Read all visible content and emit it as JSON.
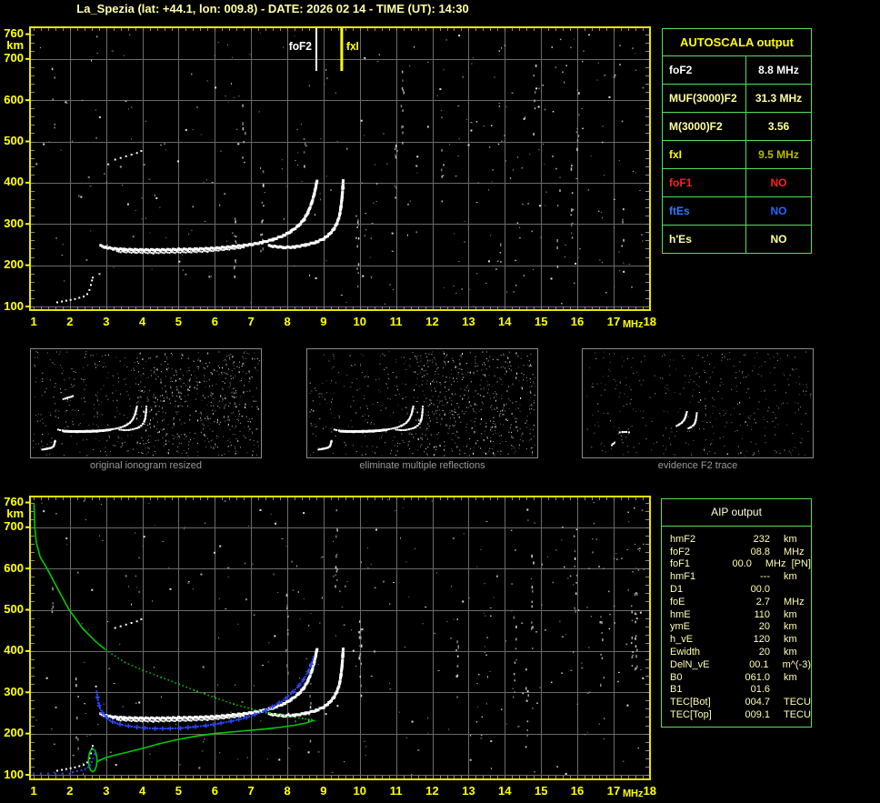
{
  "title": "La_Spezia (lat: +44.1, lon: 009.8) - DATE: 2026 02 14 - TIME (UT): 14:30",
  "colors": {
    "axis_yellow": "#ffff00",
    "plot_border": "#e8e800",
    "grid_gray": "#6a6a6a",
    "tick_gray": "#8a8a8a",
    "table_green": "#55e055",
    "trace_white": "#ffffff",
    "trace_blue": "#2a46ff",
    "profile_green": "#00cc00",
    "caption_gray": "#9a9a9a",
    "title_yellow": "#ffffa6"
  },
  "autoscala_table": {
    "title": "AUTOSCALA output",
    "rows": [
      {
        "label": "foF2",
        "value": "8.8 MHz",
        "label_color": "#ffffff",
        "value_color": "#ffffff"
      },
      {
        "label": "MUF(3000)F2",
        "value": "31.3 MHz",
        "label_color": "#ffff9c",
        "value_color": "#ffff9c"
      },
      {
        "label": "M(3000)F2",
        "value": "3.56",
        "label_color": "#ffff9c",
        "value_color": "#ffff9c"
      },
      {
        "label": "fxI",
        "value": "9.5 MHz",
        "label_color": "#ffff00",
        "value_color": "#b9b900"
      },
      {
        "label": "foF1",
        "value": "NO",
        "label_color": "#ff2020",
        "value_color": "#ff2020"
      },
      {
        "label": "ftEs",
        "value": "NO",
        "label_color": "#3377ff",
        "value_color": "#2266ff"
      },
      {
        "label": "h'Es",
        "value": "NO",
        "label_color": "#ffff9c",
        "value_color": "#ffff9c"
      }
    ]
  },
  "aip_table": {
    "title": "AIP output",
    "rows": [
      {
        "name": "hmF2",
        "value": "232",
        "unit": "km",
        "note": ""
      },
      {
        "name": "foF2",
        "value": "08.8",
        "unit": "MHz",
        "note": ""
      },
      {
        "name": "foF1",
        "value": "00.0",
        "unit": "MHz",
        "note": "  [PN]"
      },
      {
        "name": "hmF1",
        "value": "---",
        "unit": "km",
        "note": ""
      },
      {
        "name": "D1",
        "value": "00.0",
        "unit": "",
        "note": ""
      },
      {
        "name": "foE",
        "value": "2.7",
        "unit": "MHz",
        "note": ""
      },
      {
        "name": "hmE",
        "value": "110",
        "unit": "km",
        "note": ""
      },
      {
        "name": "ymE",
        "value": "20",
        "unit": "km",
        "note": ""
      },
      {
        "name": "h_vE",
        "value": "120",
        "unit": "km",
        "note": ""
      },
      {
        "name": "Ewidth",
        "value": "20",
        "unit": "km",
        "note": ""
      },
      {
        "name": "DelN_vE",
        "value": "00.1",
        "unit": "m^(-3)",
        "note": ""
      },
      {
        "name": "B0",
        "value": "061.0",
        "unit": "km",
        "note": ""
      },
      {
        "name": "B1",
        "value": "01.6",
        "unit": "",
        "note": ""
      },
      {
        "name": "TEC[Bot]",
        "value": "004.7",
        "unit": "TECU",
        "note": ""
      },
      {
        "name": "TEC[Top]",
        "value": "009.1",
        "unit": "TECU",
        "note": ""
      }
    ]
  },
  "thumbnails": [
    {
      "caption": "original ionogram resized",
      "seed": 41,
      "noise": 520,
      "extra_right": 300,
      "dim": false,
      "series": [
        "E_trace",
        "F2_O",
        "F2_upper",
        "F2_X",
        "arc460"
      ]
    },
    {
      "caption": "eliminate multiple reflections",
      "seed": 87,
      "noise": 500,
      "extra_right": 300,
      "dim": false,
      "series": [
        "E_trace",
        "F2_O",
        "F2_upper",
        "F2_X"
      ]
    },
    {
      "caption": "evidence F2 trace",
      "seed": 55,
      "noise": 330,
      "extra_right": 60,
      "dim": true,
      "series": [
        "frag_hook",
        "frag_mid",
        "frag_O_rise",
        "frag_X_rise"
      ]
    }
  ],
  "chart_data": [
    {
      "id": "top_ionogram",
      "type": "scatter",
      "xlabel": "MHz",
      "ylabel": "km",
      "xlim": [
        1,
        18
      ],
      "ylim": [
        100,
        760
      ],
      "grid": true,
      "x_ticks": [
        1,
        2,
        3,
        4,
        5,
        6,
        7,
        8,
        9,
        10,
        11,
        12,
        13,
        14,
        15,
        16,
        17,
        18
      ],
      "y_ticks": [
        760,
        700,
        600,
        500,
        400,
        300,
        200,
        100
      ],
      "markers": [
        {
          "label": "foF2",
          "f": 8.8,
          "color": "#ffffff"
        },
        {
          "label": "fxI",
          "f": 9.5,
          "color": "#ffff00"
        }
      ],
      "noise_seed": 7,
      "series": [
        "E_trace",
        "F2_O",
        "F2_upper",
        "F2_X",
        "arc460"
      ]
    },
    {
      "id": "bottom_ionogram",
      "type": "scatter",
      "xlabel": "MHz",
      "ylabel": "km",
      "xlim": [
        1,
        18
      ],
      "ylim": [
        100,
        760
      ],
      "grid": true,
      "x_ticks": [
        1,
        2,
        3,
        4,
        5,
        6,
        7,
        8,
        9,
        10,
        11,
        12,
        13,
        14,
        15,
        16,
        17,
        18
      ],
      "y_ticks": [
        760,
        700,
        600,
        500,
        400,
        300,
        200,
        100
      ],
      "markers": [],
      "noise_seed": 29,
      "series": [
        "E_trace",
        "F2_O",
        "F2_upper",
        "F2_X",
        "arc460",
        "profile_topside_solid",
        "profile_topside_dotted",
        "profile_bottomside",
        "profile_valley_loop",
        "blue_bottom",
        "blue_hook",
        "blue_main"
      ]
    }
  ],
  "series_defs": {
    "E_trace": {
      "color": "#ffffff",
      "mode": "points",
      "size": 2,
      "points": [
        [
          1.65,
          110
        ],
        [
          1.78,
          112
        ],
        [
          1.9,
          114
        ],
        [
          2.02,
          116
        ],
        [
          2.14,
          118
        ],
        [
          2.26,
          121
        ],
        [
          2.38,
          124
        ],
        [
          2.48,
          130
        ],
        [
          2.54,
          140
        ],
        [
          2.58,
          152
        ],
        [
          2.61,
          163
        ],
        [
          2.63,
          170
        ]
      ]
    },
    "F2_O": {
      "color": "#ffffff",
      "mode": "pixels",
      "size": 3,
      "points": [
        [
          2.85,
          247
        ],
        [
          3.0,
          243
        ],
        [
          3.2,
          240
        ],
        [
          3.5,
          238
        ],
        [
          4.0,
          237
        ],
        [
          4.5,
          237
        ],
        [
          5.0,
          238
        ],
        [
          5.5,
          239
        ],
        [
          6.0,
          241
        ],
        [
          6.5,
          245
        ],
        [
          7.0,
          250
        ],
        [
          7.3,
          255
        ],
        [
          7.6,
          262
        ],
        [
          7.9,
          272
        ],
        [
          8.1,
          282
        ],
        [
          8.3,
          295
        ],
        [
          8.45,
          310
        ],
        [
          8.57,
          328
        ],
        [
          8.67,
          350
        ],
        [
          8.74,
          372
        ],
        [
          8.79,
          392
        ],
        [
          8.82,
          405
        ]
      ]
    },
    "F2_upper": {
      "color": "#ffffff",
      "mode": "pixels",
      "size": 2,
      "points": [
        [
          3.3,
          233
        ],
        [
          3.8,
          231
        ],
        [
          4.3,
          230
        ],
        [
          4.8,
          231
        ],
        [
          5.3,
          232
        ],
        [
          5.8,
          234
        ],
        [
          6.3,
          238
        ],
        [
          6.8,
          243
        ]
      ]
    },
    "F2_X": {
      "color": "#ffffff",
      "mode": "pixels",
      "size": 3,
      "points": [
        [
          7.5,
          247
        ],
        [
          7.9,
          243
        ],
        [
          8.2,
          244
        ],
        [
          8.5,
          249
        ],
        [
          8.8,
          256
        ],
        [
          9.0,
          264
        ],
        [
          9.15,
          274
        ],
        [
          9.28,
          287
        ],
        [
          9.37,
          302
        ],
        [
          9.44,
          320
        ],
        [
          9.48,
          342
        ],
        [
          9.51,
          365
        ],
        [
          9.53,
          388
        ],
        [
          9.54,
          405
        ]
      ]
    },
    "arc460": {
      "color": "#ffffff",
      "mode": "points",
      "size": 2,
      "points": [
        [
          3.25,
          456
        ],
        [
          3.4,
          460
        ],
        [
          3.55,
          464
        ],
        [
          3.7,
          468
        ],
        [
          3.85,
          472
        ],
        [
          3.97,
          477
        ]
      ]
    },
    "profile_topside_solid": {
      "color": "#00cc00",
      "mode": "line",
      "size": 1.6,
      "points": [
        [
          1.01,
          757
        ],
        [
          1.03,
          700
        ],
        [
          1.08,
          660
        ],
        [
          1.18,
          628
        ],
        [
          1.37,
          600
        ],
        [
          1.62,
          558
        ],
        [
          1.98,
          500
        ],
        [
          2.35,
          455
        ],
        [
          2.7,
          424
        ],
        [
          2.96,
          405
        ]
      ]
    },
    "profile_topside_dotted": {
      "color": "#00cc00",
      "mode": "dotline",
      "size": 1.4,
      "points": [
        [
          2.96,
          405
        ],
        [
          3.5,
          374
        ],
        [
          4.0,
          355
        ],
        [
          4.5,
          338
        ],
        [
          5.0,
          321
        ],
        [
          5.5,
          304
        ],
        [
          6.0,
          288
        ],
        [
          6.5,
          273
        ],
        [
          7.0,
          261
        ],
        [
          7.5,
          251
        ],
        [
          8.0,
          243
        ],
        [
          8.4,
          238
        ],
        [
          8.65,
          235
        ],
        [
          8.73,
          232
        ]
      ]
    },
    "profile_bottomside": {
      "color": "#00cc00",
      "mode": "line",
      "size": 1.6,
      "points": [
        [
          8.73,
          232
        ],
        [
          8.55,
          226
        ],
        [
          8.2,
          220
        ],
        [
          7.8,
          215
        ],
        [
          7.4,
          211
        ],
        [
          7.0,
          208
        ],
        [
          6.5,
          204
        ],
        [
          6.0,
          200
        ],
        [
          5.5,
          194
        ],
        [
          5.0,
          186
        ],
        [
          4.5,
          176
        ],
        [
          4.0,
          164
        ],
        [
          3.6,
          155
        ],
        [
          3.2,
          147
        ],
        [
          2.95,
          140
        ],
        [
          2.8,
          134
        ],
        [
          2.75,
          131
        ]
      ]
    },
    "profile_valley_loop": {
      "color": "#00cc00",
      "mode": "line",
      "size": 1.6,
      "points": [
        [
          2.75,
          135
        ],
        [
          2.73,
          149
        ],
        [
          2.69,
          159
        ],
        [
          2.63,
          163
        ],
        [
          2.57,
          159
        ],
        [
          2.53,
          149
        ],
        [
          2.51,
          135
        ],
        [
          2.53,
          121
        ],
        [
          2.57,
          111
        ],
        [
          2.63,
          107
        ],
        [
          2.69,
          111
        ],
        [
          2.73,
          121
        ],
        [
          2.75,
          135
        ]
      ]
    },
    "blue_bottom": {
      "color": "#2a46ff",
      "mode": "points",
      "size": 2,
      "points": [
        [
          1.0,
          103
        ],
        [
          1.2,
          103
        ],
        [
          1.4,
          103
        ],
        [
          1.6,
          103
        ],
        [
          1.8,
          103
        ],
        [
          2.0,
          103
        ]
      ]
    },
    "blue_hook": {
      "color": "#2a46ff",
      "mode": "points",
      "size": 2,
      "points": [
        [
          2.08,
          106
        ],
        [
          2.2,
          109
        ],
        [
          2.32,
          111
        ],
        [
          2.42,
          114
        ],
        [
          2.5,
          118
        ],
        [
          2.56,
          124
        ],
        [
          2.6,
          131
        ],
        [
          2.64,
          140
        ],
        [
          2.68,
          150
        ],
        [
          2.7,
          158
        ]
      ]
    },
    "blue_main": {
      "color": "#2a46ff",
      "mode": "plus",
      "size": 2,
      "points": [
        [
          2.74,
          302
        ],
        [
          2.76,
          288
        ],
        [
          2.79,
          274
        ],
        [
          2.83,
          262
        ],
        [
          2.9,
          250
        ],
        [
          3.0,
          240
        ],
        [
          3.1,
          232
        ],
        [
          3.25,
          226
        ],
        [
          3.45,
          221
        ],
        [
          3.7,
          217
        ],
        [
          4.0,
          214
        ],
        [
          4.35,
          212
        ],
        [
          4.7,
          212
        ],
        [
          5.05,
          213
        ],
        [
          5.4,
          216
        ],
        [
          5.75,
          219
        ],
        [
          6.1,
          224
        ],
        [
          6.45,
          230
        ],
        [
          6.8,
          237
        ],
        [
          7.1,
          246
        ],
        [
          7.4,
          256
        ],
        [
          7.65,
          268
        ],
        [
          7.9,
          281
        ],
        [
          8.1,
          296
        ],
        [
          8.28,
          312
        ],
        [
          8.45,
          331
        ],
        [
          8.57,
          350
        ],
        [
          8.66,
          368
        ],
        [
          8.72,
          386
        ]
      ]
    },
    "frag_hook": {
      "color": "#ffffff",
      "mode": "points",
      "size": 2,
      "points": [
        [
          3.0,
          140
        ],
        [
          3.1,
          150
        ],
        [
          3.2,
          158
        ]
      ]
    },
    "frag_mid": {
      "color": "#ffffff",
      "mode": "points",
      "size": 2,
      "points": [
        [
          3.6,
          228
        ],
        [
          3.8,
          230
        ],
        [
          4.1,
          231
        ],
        [
          4.3,
          228
        ]
      ]
    },
    "frag_O_rise": {
      "color": "#ffffff",
      "mode": "points",
      "size": 2,
      "points": [
        [
          7.9,
          272
        ],
        [
          8.1,
          282
        ],
        [
          8.3,
          295
        ],
        [
          8.45,
          310
        ],
        [
          8.55,
          328
        ],
        [
          8.62,
          348
        ],
        [
          8.68,
          368
        ]
      ]
    },
    "frag_X_rise": {
      "color": "#ffffff",
      "mode": "points",
      "size": 2,
      "points": [
        [
          8.8,
          256
        ],
        [
          9.0,
          264
        ],
        [
          9.15,
          274
        ],
        [
          9.28,
          290
        ],
        [
          9.35,
          310
        ],
        [
          9.4,
          335
        ],
        [
          9.43,
          360
        ]
      ]
    }
  }
}
